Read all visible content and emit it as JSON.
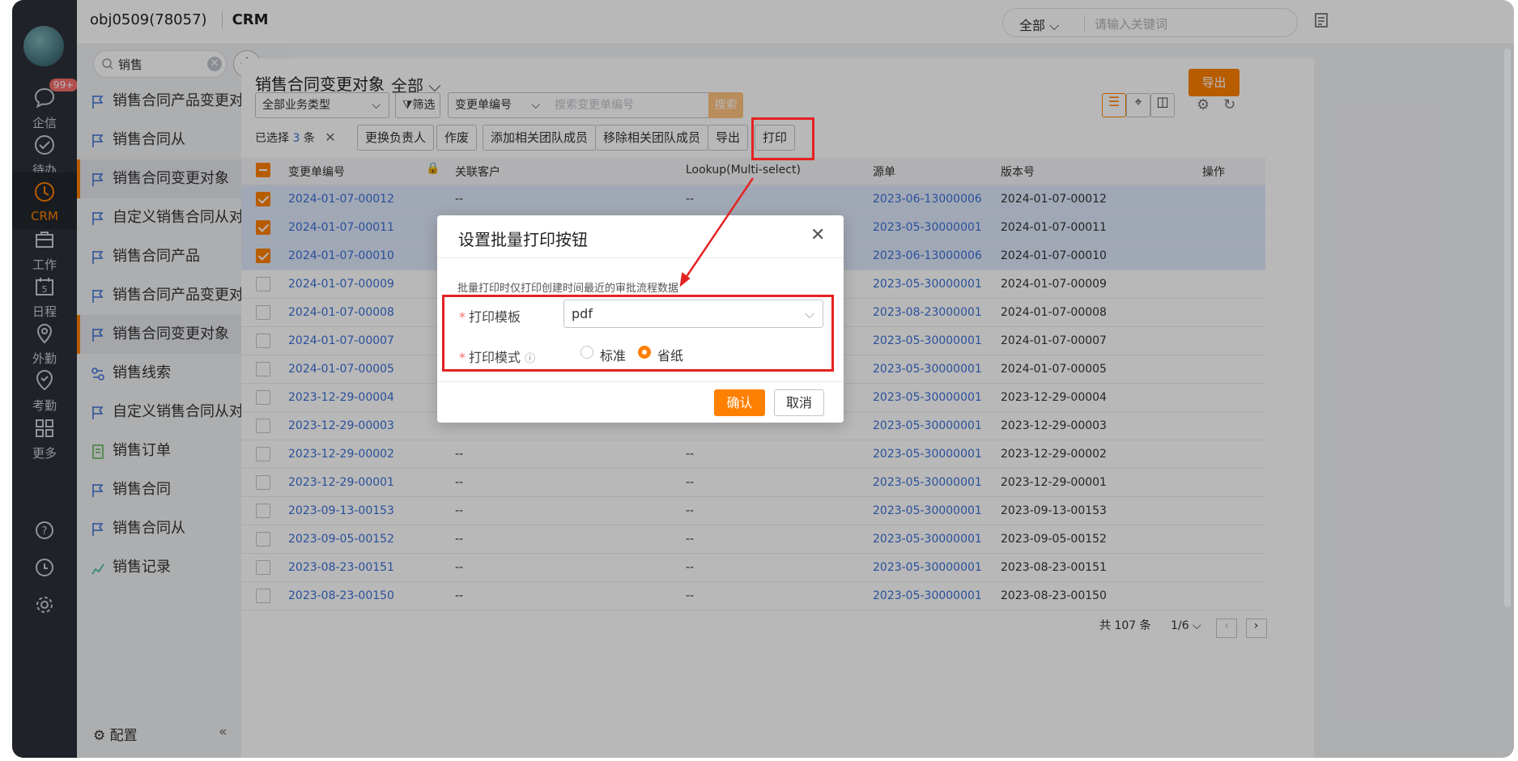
{
  "nav": {
    "badge": "99+",
    "items": [
      {
        "label": "企信",
        "icon": "chat-icon"
      },
      {
        "label": "待办",
        "icon": "check-circle-icon"
      },
      {
        "label": "CRM",
        "icon": "clock-icon"
      },
      {
        "label": "工作",
        "icon": "briefcase-icon"
      },
      {
        "label": "日程",
        "icon": "calendar-icon"
      },
      {
        "label": "外勤",
        "icon": "location-icon"
      },
      {
        "label": "考勤",
        "icon": "attendance-icon"
      },
      {
        "label": "更多",
        "icon": "grid-icon"
      }
    ],
    "calendar_day": "5",
    "bottom_icons": [
      "help-icon",
      "history-icon",
      "settings-icon"
    ]
  },
  "header": {
    "org": "obj0509(78057)",
    "app": "CRM",
    "search_scope": "全部",
    "search_placeholder": "请输入关键词"
  },
  "sidebar": {
    "search_value": "销售",
    "items": [
      {
        "label": "销售合同产品变更对象"
      },
      {
        "label": "销售合同从"
      },
      {
        "label": "销售合同变更对象",
        "selected": true
      },
      {
        "label": "自定义销售合同从对象"
      },
      {
        "label": "销售合同产品"
      },
      {
        "label": "销售合同产品变更对象"
      },
      {
        "label": "销售合同变更对象",
        "selected": true
      },
      {
        "label": "销售线索"
      },
      {
        "label": "自定义销售合同从对象"
      },
      {
        "label": "销售订单"
      },
      {
        "label": "销售合同"
      },
      {
        "label": "销售合同从"
      },
      {
        "label": "销售记录"
      }
    ],
    "footer": "配置"
  },
  "main": {
    "title": "销售合同变更对象",
    "scope": "全部",
    "export": "导出",
    "biz_type": "全部业务类型",
    "filter": "筛选",
    "search_field": "变更单编号",
    "search_placeholder": "搜索变更单编号",
    "search_btn": "搜索",
    "selected_prefix": "已选择",
    "selected_count": "3",
    "selected_suffix": "条",
    "batch": [
      "更换负责人",
      "作废",
      "添加相关团队成员",
      "移除相关团队成员",
      "导出",
      "打印"
    ],
    "columns": [
      "变更单编号",
      "关联客户",
      "Lookup(Multi-select)",
      "源单",
      "版本号",
      "操作"
    ],
    "rows": [
      {
        "id": "2024-01-07-00012",
        "cust": "--",
        "lookup": "--",
        "src": "2023-06-13000006",
        "ver": "2024-01-07-00012",
        "checked": true
      },
      {
        "id": "2024-01-07-00011",
        "cust": "",
        "lookup": "",
        "src": "2023-05-30000001",
        "ver": "2024-01-07-00011",
        "checked": true
      },
      {
        "id": "2024-01-07-00010",
        "cust": "",
        "lookup": "",
        "src": "2023-06-13000006",
        "ver": "2024-01-07-00010",
        "checked": true
      },
      {
        "id": "2024-01-07-00009",
        "cust": "",
        "lookup": "",
        "src": "2023-05-30000001",
        "ver": "2024-01-07-00009",
        "checked": false
      },
      {
        "id": "2024-01-07-00008",
        "cust": "",
        "lookup": "",
        "src": "2023-08-23000001",
        "ver": "2024-01-07-00008",
        "checked": false
      },
      {
        "id": "2024-01-07-00007",
        "cust": "",
        "lookup": "",
        "src": "2023-05-30000001",
        "ver": "2024-01-07-00007",
        "checked": false
      },
      {
        "id": "2024-01-07-00005",
        "cust": "",
        "lookup": "",
        "src": "2023-05-30000001",
        "ver": "2024-01-07-00005",
        "checked": false
      },
      {
        "id": "2023-12-29-00004",
        "cust": "",
        "lookup": "",
        "src": "2023-05-30000001",
        "ver": "2023-12-29-00004",
        "checked": false
      },
      {
        "id": "2023-12-29-00003",
        "cust": "",
        "lookup": "",
        "src": "2023-05-30000001",
        "ver": "2023-12-29-00003",
        "checked": false
      },
      {
        "id": "2023-12-29-00002",
        "cust": "--",
        "lookup": "--",
        "src": "2023-05-30000001",
        "ver": "2023-12-29-00002",
        "checked": false
      },
      {
        "id": "2023-12-29-00001",
        "cust": "--",
        "lookup": "--",
        "src": "2023-05-30000001",
        "ver": "2023-12-29-00001",
        "checked": false
      },
      {
        "id": "2023-09-13-00153",
        "cust": "--",
        "lookup": "--",
        "src": "2023-05-30000001",
        "ver": "2023-09-13-00153",
        "checked": false
      },
      {
        "id": "2023-09-05-00152",
        "cust": "--",
        "lookup": "--",
        "src": "2023-05-30000001",
        "ver": "2023-09-05-00152",
        "checked": false
      },
      {
        "id": "2023-08-23-00151",
        "cust": "--",
        "lookup": "--",
        "src": "2023-05-30000001",
        "ver": "2023-08-23-00151",
        "checked": false
      },
      {
        "id": "2023-08-23-00150",
        "cust": "--",
        "lookup": "--",
        "src": "2023-05-30000001",
        "ver": "2023-08-23-00150",
        "checked": false
      }
    ],
    "total": "共 107 条",
    "page": "1/6"
  },
  "dialog": {
    "title": "设置批量打印按钮",
    "hint": "批量打印时仅打印创建时间最近的审批流程数据",
    "template_label": "打印模板",
    "template_value": "pdf",
    "mode_label": "打印模式",
    "mode_standard": "标准",
    "mode_save": "省纸",
    "mode_selected": "省纸",
    "ok": "确认",
    "cancel": "取消"
  },
  "colors": {
    "accent": "#ff8000",
    "link": "#3a6fd8",
    "annotation": "#e52222"
  }
}
